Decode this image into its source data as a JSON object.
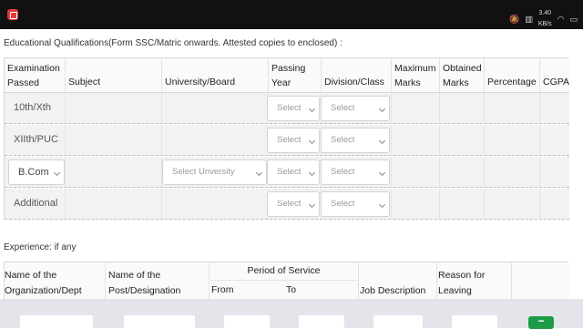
{
  "statusbar": {
    "net_speed_top": "3.40",
    "net_speed_bottom": "KB/s"
  },
  "qualifications": {
    "title": "Educational Qualifications(Form SSC/Matric onwards. Attested copies to enclosed) :",
    "headers": {
      "exam_line1": "Examination",
      "exam_line2": "Passed",
      "subject": "Subject",
      "board": "University/Board",
      "year_line1": "Passing",
      "year_line2": "Year",
      "division": "Division/Class",
      "max_line1": "Maximum",
      "max_line2": "Marks",
      "obt_line1": "Obtained",
      "obt_line2": "Marks",
      "percentage": "Percentage",
      "cgpa": "CGPA"
    },
    "rows": [
      {
        "exam": "10th/Xth",
        "year": "Select",
        "division": "Select"
      },
      {
        "exam": "XIIth/PUC",
        "year": "Select",
        "division": "Select"
      },
      {
        "exam": "B.Com",
        "board": "Select Unversity",
        "year": "Select",
        "division": "Select"
      },
      {
        "exam": "Additional",
        "year": "Select",
        "division": "Select"
      }
    ]
  },
  "experience": {
    "title": "Experience: if any",
    "headers": {
      "org_line1": "Name of the",
      "org_line2": "Organization/Dept",
      "post_line1": "Name of the",
      "post_line2": "Post/Designation",
      "period": "Period of Service",
      "from": "From",
      "to": "To",
      "job": "Job Description",
      "reason_line1": "Reason for",
      "reason_line2": "Leaving"
    },
    "add_label": "−"
  }
}
